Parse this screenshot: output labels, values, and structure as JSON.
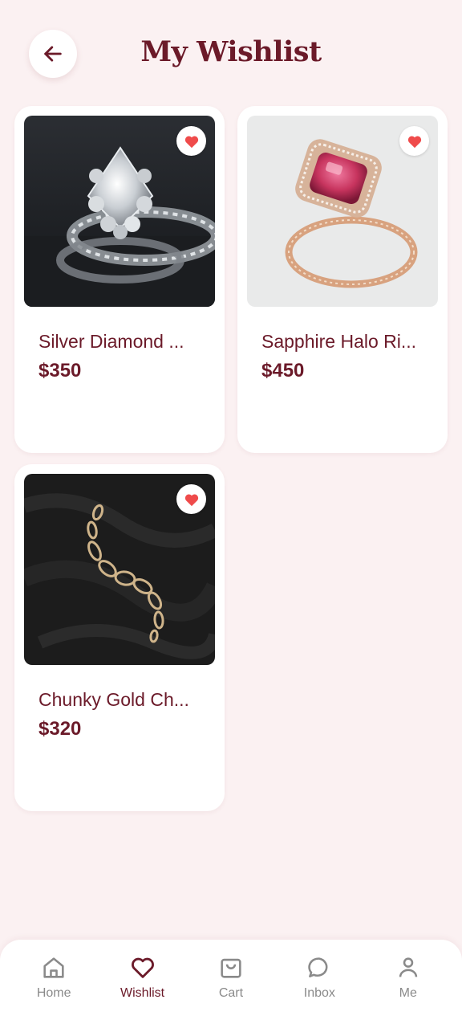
{
  "header": {
    "title": "My Wishlist"
  },
  "products": [
    {
      "name": "Silver Diamond ...",
      "price": "$350",
      "image": "silver-diamond-ring-photo"
    },
    {
      "name": "Sapphire Halo Ri...",
      "price": "$450",
      "image": "sapphire-halo-ring-photo"
    },
    {
      "name": "Chunky Gold Ch...",
      "price": "$320",
      "image": "gold-chain-photo"
    }
  ],
  "nav": {
    "items": [
      {
        "label": "Home",
        "icon": "home-icon"
      },
      {
        "label": "Wishlist",
        "icon": "heart-icon",
        "active": true
      },
      {
        "label": "Cart",
        "icon": "shopping-bag-icon"
      },
      {
        "label": "Inbox",
        "icon": "chat-bubble-icon"
      },
      {
        "label": "Me",
        "icon": "person-icon"
      }
    ]
  },
  "colors": {
    "background": "#fbf1f2",
    "brand": "#6b1a29",
    "heart": "#ef4b4b",
    "inactive_nav": "#8a8a8a"
  }
}
